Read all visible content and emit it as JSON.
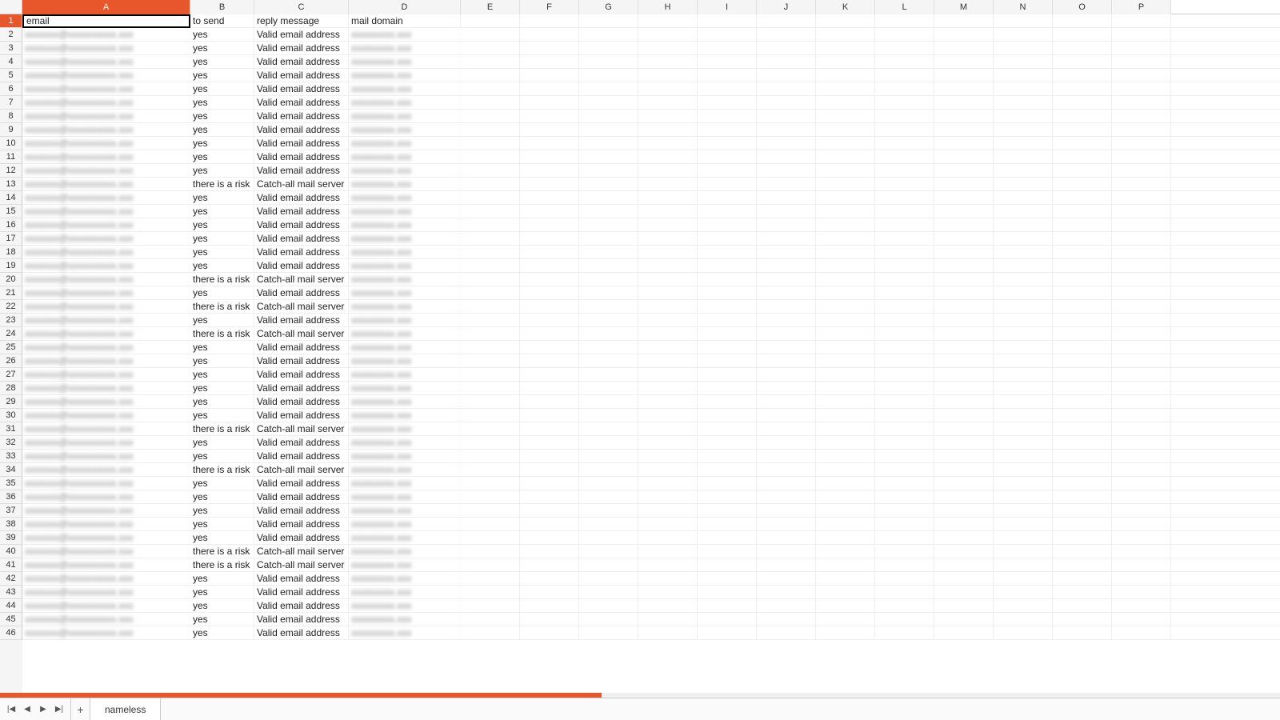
{
  "columns": [
    "A",
    "B",
    "C",
    "D",
    "E",
    "F",
    "G",
    "H",
    "I",
    "J",
    "K",
    "L",
    "M",
    "N",
    "O",
    "P"
  ],
  "selected_column": "A",
  "selected_row": 1,
  "selected_cell": "A1",
  "headers": {
    "A": "email",
    "B": "to send",
    "C": "reply message",
    "D": "mail domain"
  },
  "rows": [
    {
      "b": "yes",
      "c": "Valid email address"
    },
    {
      "b": "yes",
      "c": "Valid email address"
    },
    {
      "b": "yes",
      "c": "Valid email address"
    },
    {
      "b": "yes",
      "c": "Valid email address"
    },
    {
      "b": "yes",
      "c": "Valid email address"
    },
    {
      "b": "yes",
      "c": "Valid email address"
    },
    {
      "b": "yes",
      "c": "Valid email address"
    },
    {
      "b": "yes",
      "c": "Valid email address"
    },
    {
      "b": "yes",
      "c": "Valid email address"
    },
    {
      "b": "yes",
      "c": "Valid email address"
    },
    {
      "b": "yes",
      "c": "Valid email address"
    },
    {
      "b": "there is a risk",
      "c": "Catch-all mail server"
    },
    {
      "b": "yes",
      "c": "Valid email address"
    },
    {
      "b": "yes",
      "c": "Valid email address"
    },
    {
      "b": "yes",
      "c": "Valid email address"
    },
    {
      "b": "yes",
      "c": "Valid email address"
    },
    {
      "b": "yes",
      "c": "Valid email address"
    },
    {
      "b": "yes",
      "c": "Valid email address"
    },
    {
      "b": "there is a risk",
      "c": "Catch-all mail server"
    },
    {
      "b": "yes",
      "c": "Valid email address"
    },
    {
      "b": "there is a risk",
      "c": "Catch-all mail server"
    },
    {
      "b": "yes",
      "c": "Valid email address"
    },
    {
      "b": "there is a risk",
      "c": "Catch-all mail server"
    },
    {
      "b": "yes",
      "c": "Valid email address"
    },
    {
      "b": "yes",
      "c": "Valid email address"
    },
    {
      "b": "yes",
      "c": "Valid email address"
    },
    {
      "b": "yes",
      "c": "Valid email address"
    },
    {
      "b": "yes",
      "c": "Valid email address"
    },
    {
      "b": "yes",
      "c": "Valid email address"
    },
    {
      "b": "there is a risk",
      "c": "Catch-all mail server"
    },
    {
      "b": "yes",
      "c": "Valid email address"
    },
    {
      "b": "yes",
      "c": "Valid email address"
    },
    {
      "b": "there is a risk",
      "c": "Catch-all mail server"
    },
    {
      "b": "yes",
      "c": "Valid email address"
    },
    {
      "b": "yes",
      "c": "Valid email address"
    },
    {
      "b": "yes",
      "c": "Valid email address"
    },
    {
      "b": "yes",
      "c": "Valid email address"
    },
    {
      "b": "yes",
      "c": "Valid email address"
    },
    {
      "b": "there is a risk",
      "c": "Catch-all mail server"
    },
    {
      "b": "there is a risk",
      "c": "Catch-all mail server"
    },
    {
      "b": "yes",
      "c": "Valid email address"
    },
    {
      "b": "yes",
      "c": "Valid email address"
    },
    {
      "b": "yes",
      "c": "Valid email address"
    },
    {
      "b": "yes",
      "c": "Valid email address"
    },
    {
      "b": "yes",
      "c": "Valid email address"
    }
  ],
  "visible_row_count": 46,
  "sheet_tab": "nameless",
  "nav": {
    "first": "|◀",
    "prev": "◀",
    "next": "▶",
    "last": "▶|",
    "add": "+"
  }
}
